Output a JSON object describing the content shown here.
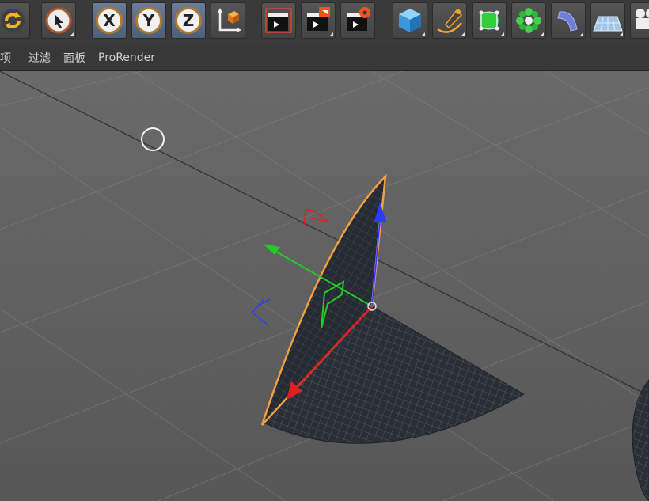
{
  "menu": {
    "items": [
      {
        "label": "项"
      },
      {
        "label": "过滤"
      },
      {
        "label": "面板"
      },
      {
        "label": "ProRender"
      }
    ]
  },
  "toolbar": {
    "axis_x": "X",
    "axis_y": "Y",
    "axis_z": "Z"
  },
  "icons": {
    "undo": "rotate-arrows-icon",
    "select": "cursor-arrow-icon",
    "coord": "coordinate-system-icon",
    "render_view": "render-view-icon",
    "render_picture": "render-to-picture-viewer-icon",
    "render_settings": "render-settings-icon",
    "cube": "cube-primitive-icon",
    "pen": "spline-pen-icon",
    "subdivision": "subdivision-surface-icon",
    "cloner": "mograph-cloner-icon",
    "deformer": "bend-deformer-icon",
    "floor": "floor-object-icon",
    "camera": "camera-icon"
  },
  "colors": {
    "toolbar_bg": "#3a3a3a",
    "viewport_bg": "#5f5f5f",
    "selection_outline": "#e8913a",
    "axis_x": "#e02020",
    "axis_y": "#22cc22",
    "axis_z": "#2a3cff"
  }
}
